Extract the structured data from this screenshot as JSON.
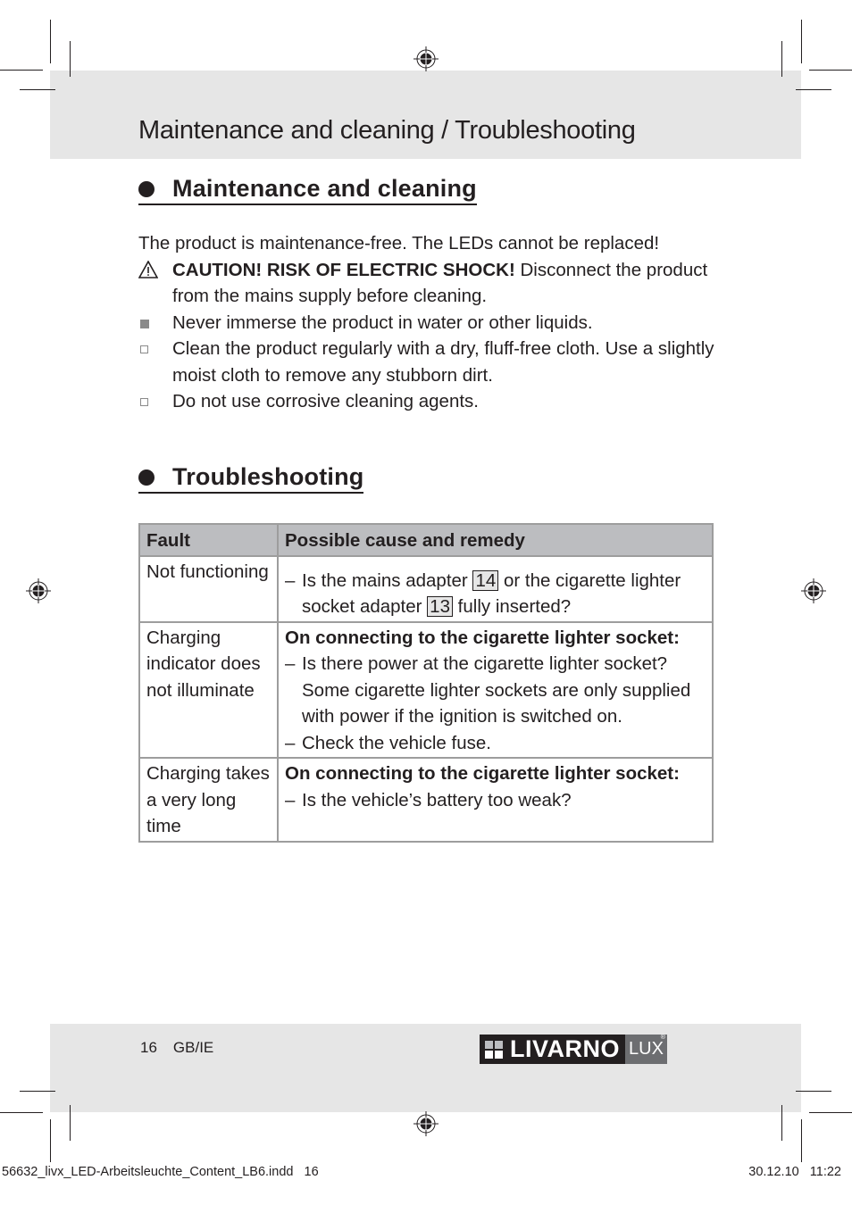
{
  "header": {
    "title": "Maintenance and cleaning / Troubleshooting"
  },
  "maintenance": {
    "heading": "Maintenance and cleaning",
    "intro": "The product is maintenance-free. The LEDs cannot be replaced!",
    "caution": {
      "icon": "warning-triangle-icon",
      "bold": "CAUTION! RISK OF ELECTRIC SHOCK!",
      "text": " Disconnect the product from the mains supply before cleaning."
    },
    "items": [
      {
        "marker": "filled-square",
        "text": "Never immerse the product in water or other liquids."
      },
      {
        "marker": "open-square",
        "text": "Clean the product regularly with a dry, fluff-free cloth. Use a slightly moist cloth to remove any stubborn dirt."
      },
      {
        "marker": "open-square",
        "text": "Do not use corrosive cleaning agents."
      }
    ]
  },
  "troubleshooting": {
    "heading": "Troubleshooting",
    "table": {
      "headers": [
        "Fault",
        "Possible cause and remedy"
      ],
      "rows": [
        {
          "fault": "Not functioning",
          "remedy_parts": {
            "dash": "–",
            "t1": "Is the mains adapter ",
            "ref1": "14",
            "t2": " or the cigarette lighter socket adapter ",
            "ref2": "13",
            "t3": " fully inserted?"
          }
        },
        {
          "fault": "Charging indicator does not illuminate",
          "condition": "On connecting to the cigarette lighter socket:",
          "remedies": [
            "Is there power at the cigarette lighter socket? Some cigarette lighter sockets are only supplied with power if the ignition is switched on.",
            "Check the vehicle fuse."
          ]
        },
        {
          "fault": "Charging takes a very long time",
          "condition": "On connecting to the cigarette lighter socket:",
          "remedies": [
            "Is the vehicle’s battery too weak?"
          ]
        }
      ]
    }
  },
  "footer": {
    "page_number": "16",
    "locale": "GB/IE",
    "logo_brand": "LIVARNO",
    "logo_sub": "LUX",
    "logo_registered": "®"
  },
  "slug": {
    "file": "56632_livx_LED-Arbeitsleuchte_Content_LB6.indd   16",
    "datetime": "30.12.10   11:22"
  },
  "dash": "–",
  "colors": {
    "band": "#e6e6e6",
    "table_header": "#bcbdc0",
    "table_border": "#9d9d9d",
    "text": "#231f20",
    "logo_dark": "#231f20",
    "logo_gray": "#6d6e71"
  }
}
